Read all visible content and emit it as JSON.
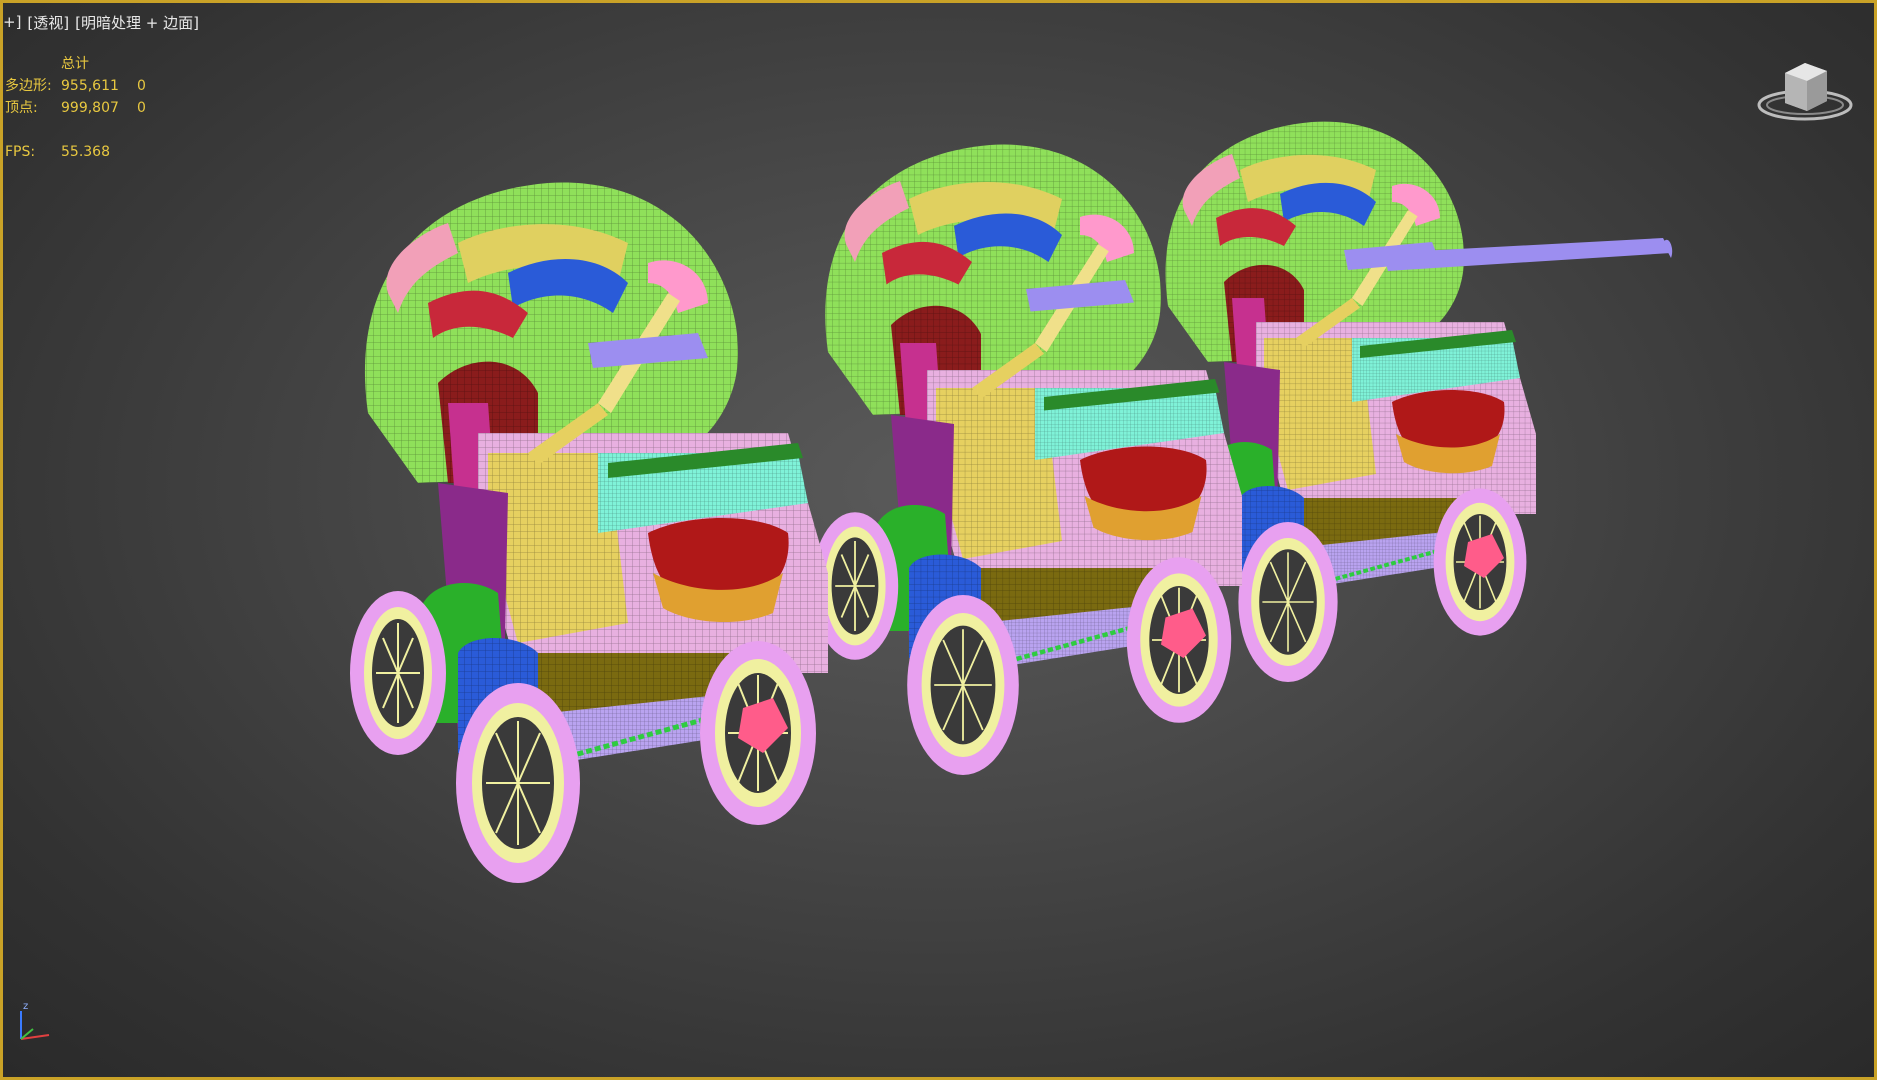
{
  "viewport": {
    "label": {
      "menu_glyph": "+]",
      "view": "[透视]",
      "shading": "[明暗处理 + 边面]"
    },
    "stats": {
      "header": "总计",
      "polygons_label": "多边形:",
      "polygons_total": "955,611",
      "polygons_selected": "0",
      "vertices_label": "顶点:",
      "vertices_total": "999,807",
      "vertices_selected": "0",
      "fps_label": "FPS:",
      "fps_value": "55.368"
    },
    "navigation": {
      "viewcube_icon": "viewcube-icon",
      "axis_icon": "axis-tripod-icon",
      "axis_z": "z"
    },
    "scene": {
      "object": "three baby strollers shown in wireframe, colored by material",
      "stroller_count": 3
    },
    "colors": {
      "frame_border": "#c9a227",
      "stats_text": "#e8c840",
      "label_text": "#e8e8e8"
    }
  }
}
